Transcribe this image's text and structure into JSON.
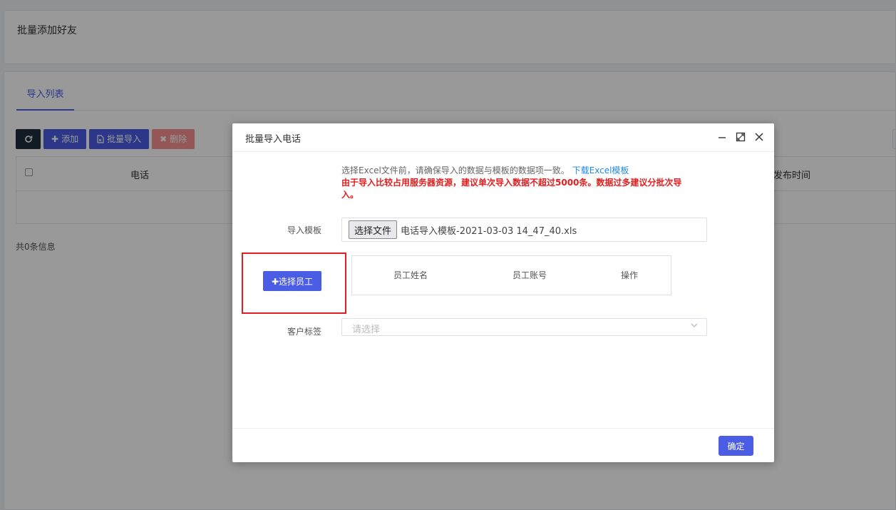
{
  "page": {
    "title": "批量添加好友",
    "tab": "导入列表",
    "toolbar": {
      "refresh_icon": "refresh-icon",
      "add_label": "添加",
      "batch_import_label": "批量导入",
      "delete_label": "删除"
    },
    "table": {
      "col_phone": "电话",
      "col_publish_time": "发布时间"
    },
    "total_text": "共0条信息"
  },
  "dialog": {
    "title": "批量导入电话",
    "hint_text": "选择Excel文件前，请确保导入的数据与模板的数据项一致。",
    "download_link": "下载Excel模板",
    "warning": "由于导入比较占用服务器资源，建议单次导入数据不超过5000条。数据过多建议分批次导入。",
    "template_label": "导入模板",
    "file_button": "选择文件",
    "file_name": "电话导入模板-2021-03-03 14_47_40.xls",
    "pick_employee_button": "✚选择员工",
    "employee_table": {
      "col_name": "员工姓名",
      "col_account": "员工账号",
      "col_action": "操作"
    },
    "tag_label": "客户标签",
    "tag_placeholder": "请选择",
    "confirm_button": "确定"
  },
  "colors": {
    "primary": "#4b5de4",
    "danger": "#f56c6c",
    "warning_text": "#e02020",
    "link": "#1e88e5",
    "highlight_border": "#e02020"
  }
}
